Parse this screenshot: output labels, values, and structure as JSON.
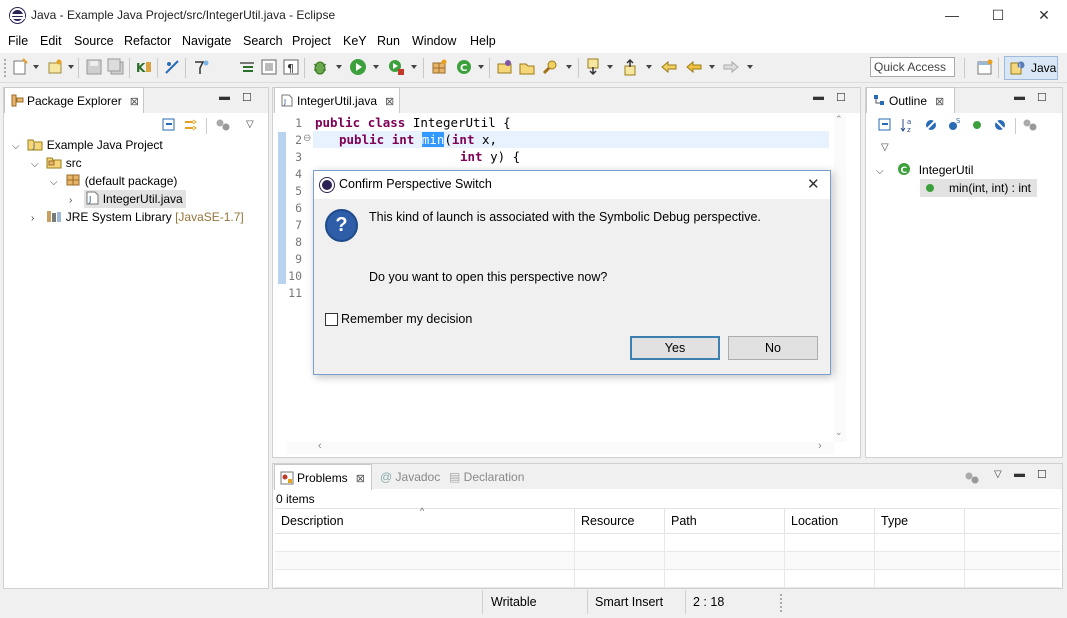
{
  "window": {
    "title": "Java - Example Java Project/src/IntegerUtil.java - Eclipse",
    "minimize": "—",
    "maximize": "☐",
    "close": "✕"
  },
  "menu": [
    "File",
    "Edit",
    "Source",
    "Refactor",
    "Navigate",
    "Search",
    "Project",
    "KeY",
    "Run",
    "Window",
    "Help"
  ],
  "toolbar": {
    "quick_access_placeholder": "Quick Access",
    "perspective_label": "Java"
  },
  "package_explorer": {
    "tab_label": "Package Explorer",
    "tree": {
      "project": "Example Java Project",
      "src": "src",
      "package": "(default package)",
      "file": "IntegerUtil.java",
      "jre": "JRE System Library",
      "jre_version": "[JavaSE-1.7]"
    }
  },
  "editor": {
    "tab_label": "IntegerUtil.java",
    "line_numbers": [
      "1",
      "2",
      "3",
      "4",
      "5",
      "6",
      "7",
      "8",
      "9",
      "10",
      "11"
    ],
    "line1": {
      "kw1": "public",
      "kw2": "class",
      "rest": " IntegerUtil {"
    },
    "line2": {
      "kw1": "public",
      "kw2": "int",
      "selected": "min",
      "paren": "(",
      "kw3": "int",
      "rest": " x,"
    },
    "line3": {
      "kw1": "int",
      "rest": " y) {"
    }
  },
  "outline": {
    "tab_label": "Outline",
    "class_name": "IntegerUtil",
    "method": "min(int, int) : int"
  },
  "dialog": {
    "title": "Confirm Perspective Switch",
    "message1": "This kind of launch is associated with the Symbolic Debug perspective.",
    "message2": "Do you want to open this perspective now?",
    "checkbox_label": "Remember my decision",
    "yes_label": "Yes",
    "no_label": "No",
    "icon_glyph": "?"
  },
  "problems": {
    "tabs": [
      "Problems",
      "Javadoc",
      "Declaration"
    ],
    "count": "0 items",
    "columns": [
      "Description",
      "Resource",
      "Path",
      "Location",
      "Type"
    ]
  },
  "statusbar": {
    "writable": "Writable",
    "insert_mode": "Smart Insert",
    "position": "2 : 18"
  },
  "colors": {
    "keyword": "#7f0055",
    "selection": "#3399ff",
    "dialog_default_border": "#3c7fb1",
    "perspective_active": "#d8e6f5"
  }
}
